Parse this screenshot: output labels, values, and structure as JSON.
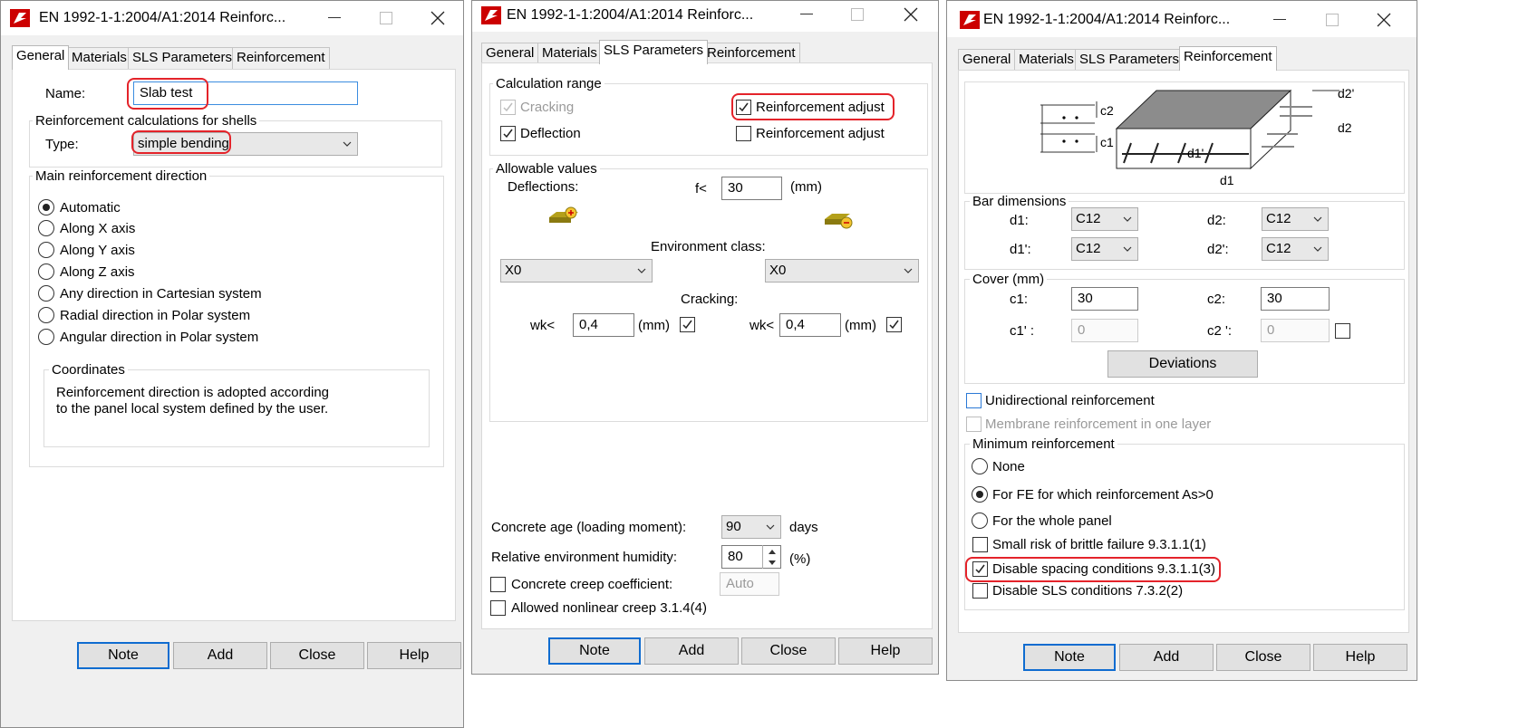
{
  "window1": {
    "title": "EN 1992-1-1:2004/A1:2014 Reinforc...",
    "tabs": [
      "General",
      "Materials",
      "SLS Parameters",
      "Reinforcement"
    ],
    "name_label": "Name:",
    "name_value": "Slab test",
    "shells_group": "Reinforcement calculations for shells",
    "type_label": "Type:",
    "type_value": "simple bending",
    "direction_group": "Main reinforcement direction",
    "directions": [
      "Automatic",
      "Along X axis",
      "Along Y axis",
      "Along Z axis",
      "Any direction in Cartesian system",
      "Radial direction in Polar system",
      "Angular direction in Polar system"
    ],
    "selected_direction": "Automatic",
    "coordinates_group": "Coordinates",
    "coordinates_text_1": "Reinforcement direction is adopted according",
    "coordinates_text_2": "to the panel local system defined by the user.",
    "buttons": [
      "Note",
      "Add",
      "Close",
      "Help"
    ]
  },
  "window2": {
    "title": "EN 1992-1-1:2004/A1:2014 Reinforc...",
    "tabs": [
      "General",
      "Materials",
      "SLS Parameters",
      "Reinforcement"
    ],
    "calc_range_group": "Calculation range",
    "cracking_label": "Cracking",
    "deflection_label": "Deflection",
    "reinf_adjust_1": "Reinforcement adjust",
    "reinf_adjust_2": "Reinforcement adjust",
    "allowable_group": "Allowable values",
    "deflections_label": "Deflections:",
    "f_label": "f<",
    "f_value": "30",
    "mm_1": "(mm)",
    "env_class_label": "Environment class:",
    "env_left": "X0",
    "env_right": "X0",
    "cracking_label2": "Cracking:",
    "wk_label_1": "wk<",
    "wk_value_1": "0,4",
    "wk_mm_1": "(mm)",
    "wk_label_2": "wk<",
    "wk_value_2": "0,4",
    "wk_mm_2": "(mm)",
    "concrete_age_label": "Concrete age (loading moment):",
    "concrete_age_value": "90",
    "days_label": "days",
    "humidity_label": "Relative environment humidity:",
    "humidity_value": "80",
    "percent_label": "(%)",
    "creep_coef_label": "Concrete creep coefficient:",
    "creep_coef_value": "Auto",
    "nonlinear_creep_label": "Allowed nonlinear creep 3.1.4(4)",
    "buttons": [
      "Note",
      "Add",
      "Close",
      "Help"
    ]
  },
  "window3": {
    "title": "EN 1992-1-1:2004/A1:2014 Reinforc...",
    "tabs": [
      "General",
      "Materials",
      "SLS Parameters",
      "Reinforcement"
    ],
    "diagram_labels": {
      "c2": "c2",
      "c1": "c1",
      "d2p": "d2'",
      "d2": "d2",
      "d1p": "d1'",
      "d1": "d1"
    },
    "bar_dim_group": "Bar dimensions",
    "d1_label": "d1:",
    "d1_value": "C12",
    "d2_label": "d2:",
    "d2_value": "C12",
    "d1p_label": "d1':",
    "d1p_value": "C12",
    "d2p_label": "d2':",
    "d2p_value": "C12",
    "cover_group": "Cover (mm)",
    "c1_label": "c1:",
    "c1_value": "30",
    "c2_label": "c2:",
    "c2_value": "30",
    "c1p_label": "c1' :",
    "c1p_value": "0",
    "c2p_label": "c2 ':",
    "c2p_value": "0",
    "deviations_label": "Deviations",
    "unidirectional_label": "Unidirectional reinforcement",
    "membrane_label": "Membrane reinforcement in one layer",
    "min_reinf_group": "Minimum reinforcement",
    "min_options": [
      "None",
      "For FE for which reinforcement As>0",
      "For the whole panel"
    ],
    "selected_min": "For FE for which reinforcement As>0",
    "brittle_label": "Small risk of brittle failure  9.3.1.1(1)",
    "spacing_label": "Disable spacing conditions 9.3.1.1(3)",
    "sls_label": "Disable SLS conditions 7.3.2(2)",
    "buttons": [
      "Note",
      "Add",
      "Close",
      "Help"
    ]
  }
}
